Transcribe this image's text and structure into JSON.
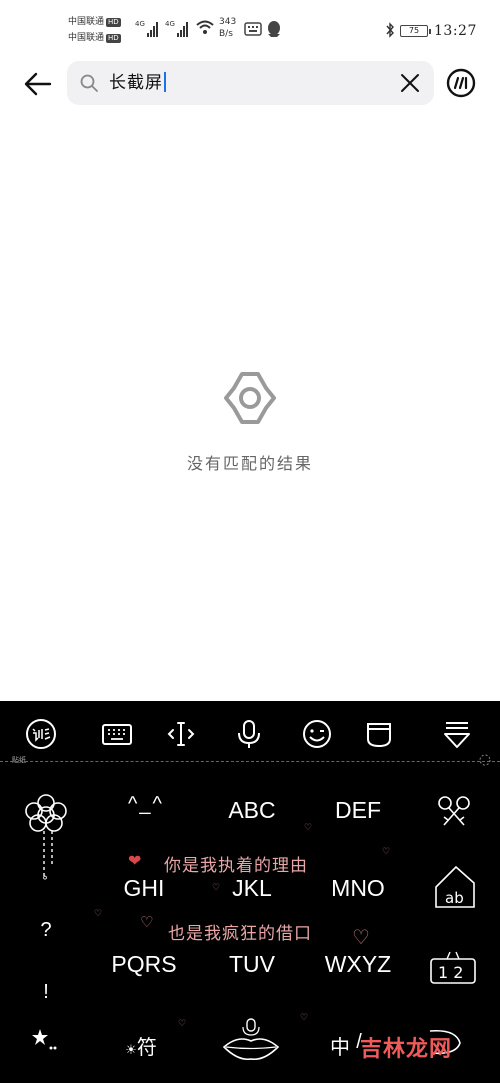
{
  "status_bar": {
    "carrier1": "中国联通",
    "carrier2": "中国联通",
    "hd": "HD",
    "network1": "4G",
    "network2": "4G",
    "speed_value": "343",
    "speed_unit": "B/s",
    "battery": "75",
    "time": "13:27"
  },
  "search": {
    "query": "长截屏"
  },
  "empty_state": {
    "message": "没有匹配的结果"
  },
  "keyboard": {
    "tag": "贴纸",
    "keys": {
      "face": "^_^",
      "abc": "ABC",
      "def": "DEF",
      "ghi": "GHI",
      "jkl": "JKL",
      "mno": "MNO",
      "pqrs": "PQRS",
      "tuv": "TUV",
      "wxyz": "WXYZ",
      "question": "?",
      "exclaim": "!",
      "symbol": "符",
      "lang": "中",
      "slash": "/"
    },
    "deco_line1": "你是我执着的理由",
    "deco_line2": "也是我疯狂的借口",
    "num_label": "1 2",
    "ab_label": "ab"
  },
  "watermark": "吉林龙网"
}
